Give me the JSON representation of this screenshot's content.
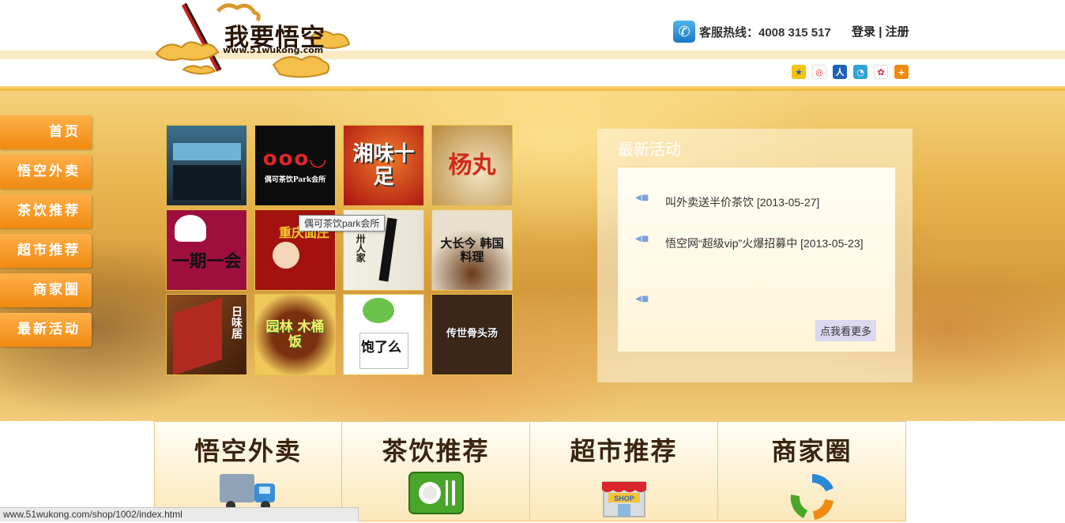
{
  "header": {
    "logo_title": "我要悟空",
    "logo_url": "www.51wukong.com",
    "hotline": "客服热线：4008 315 517",
    "login": "登录",
    "separator": "|",
    "register": "注册",
    "share_icons": [
      "qzone-icon",
      "weibo-icon",
      "renren-icon",
      "tencent-weibo-icon",
      "kaixin-icon",
      "more-share-icon"
    ]
  },
  "nav": {
    "items": [
      {
        "label": "首页"
      },
      {
        "label": "悟空外卖"
      },
      {
        "label": "茶饮推荐"
      },
      {
        "label": "超市推荐"
      },
      {
        "label": "商家圈"
      },
      {
        "label": "最新活动"
      }
    ]
  },
  "tiles": [
    {
      "text": "",
      "bg": "#2b4b6a"
    },
    {
      "text": "偶可茶饮Park会所",
      "bg": "#0c0c0c"
    },
    {
      "text": "湘味十足",
      "bg": "#b8161a"
    },
    {
      "text": "杨丸",
      "bg": "#c7a15c"
    },
    {
      "text": "一期一会",
      "bg": "#9e0f3d"
    },
    {
      "text": "重庆面庄",
      "bg": "#a3120e"
    },
    {
      "text": "卅人家",
      "bg": "#f2f2ea"
    },
    {
      "text": "大长今 韩国料理",
      "bg": "#d9d2c0"
    },
    {
      "text": "日味居",
      "bg": "#6b3416"
    },
    {
      "text": "园林 木桶饭",
      "bg": "#6b2a0c"
    },
    {
      "text": "饱了么",
      "bg": "#ffffff"
    },
    {
      "text": "传世骨头汤",
      "bg": "#3b2618"
    }
  ],
  "tooltip": "偶可茶饮park会所",
  "news": {
    "title": "最新活动",
    "items": [
      {
        "text": "叫外卖送半价茶饮 [2013-05-27]"
      },
      {
        "text": "悟空网“超级vip”火爆招募中 [2013-05-23]"
      },
      {
        "text": ""
      }
    ],
    "more": "点我看更多"
  },
  "categories": [
    {
      "label": "悟空外卖",
      "icon": "delivery-truck-icon"
    },
    {
      "label": "茶饮推荐",
      "icon": "plate-cutlery-icon"
    },
    {
      "label": "超市推荐",
      "icon": "shop-icon"
    },
    {
      "label": "商家圈",
      "icon": "recycle-arrows-icon"
    }
  ],
  "status_url": "www.51wukong.com/shop/1002/index.html"
}
